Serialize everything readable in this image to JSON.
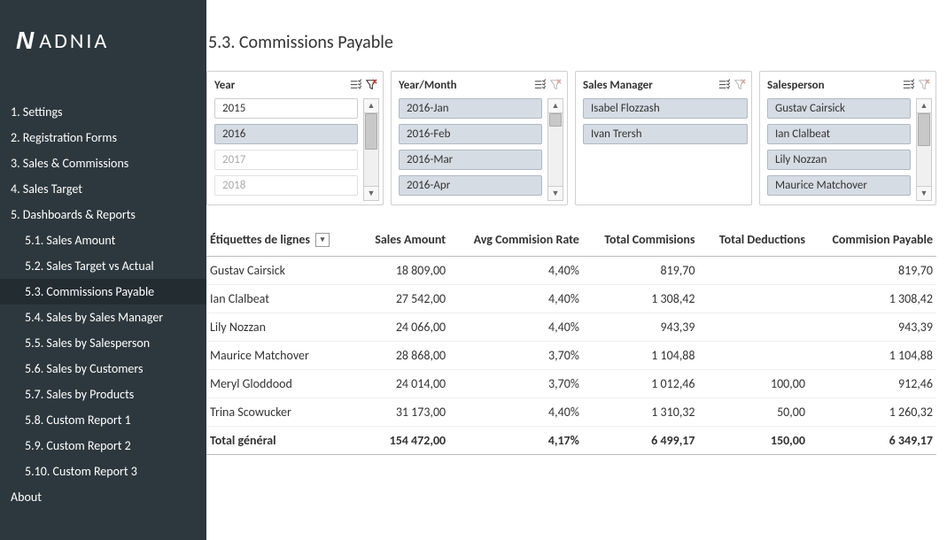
{
  "brand": {
    "logo_text": "ADNIA"
  },
  "page_title": "5.3. Commissions Payable",
  "sidebar": {
    "items": [
      {
        "label": "1. Settings",
        "sub": false
      },
      {
        "label": "2. Registration Forms",
        "sub": false
      },
      {
        "label": "3. Sales & Commissions",
        "sub": false
      },
      {
        "label": "4. Sales Target",
        "sub": false
      },
      {
        "label": "5. Dashboards & Reports",
        "sub": false
      },
      {
        "label": "5.1. Sales Amount",
        "sub": true
      },
      {
        "label": "5.2. Sales Target vs Actual",
        "sub": true
      },
      {
        "label": "5.3. Commissions Payable",
        "sub": true,
        "active": true
      },
      {
        "label": "5.4. Sales by Sales Manager",
        "sub": true
      },
      {
        "label": "5.5. Sales by Salesperson",
        "sub": true
      },
      {
        "label": "5.6. Sales by Customers",
        "sub": true
      },
      {
        "label": "5.7. Sales by Products",
        "sub": true
      },
      {
        "label": "5.8. Custom Report 1",
        "sub": true
      },
      {
        "label": "5.9. Custom Report 2",
        "sub": true
      },
      {
        "label": "5.10. Custom Report 3",
        "sub": true
      },
      {
        "label": "About",
        "sub": false
      }
    ]
  },
  "slicers": {
    "year": {
      "title": "Year",
      "items": [
        {
          "label": "2015",
          "state": "normal"
        },
        {
          "label": "2016",
          "state": "selected"
        },
        {
          "label": "2017",
          "state": "faded"
        },
        {
          "label": "2018",
          "state": "faded"
        }
      ],
      "clear_active": true,
      "scroll_thumb": {
        "top": 0,
        "height": 50
      }
    },
    "year_month": {
      "title": "Year/Month",
      "items": [
        {
          "label": "2016-Jan",
          "state": "selected"
        },
        {
          "label": "2016-Feb",
          "state": "selected"
        },
        {
          "label": "2016-Mar",
          "state": "selected"
        },
        {
          "label": "2016-Apr",
          "state": "selected"
        }
      ],
      "clear_active": false,
      "scroll_thumb": {
        "top": 0,
        "height": 18
      }
    },
    "sales_manager": {
      "title": "Sales Manager",
      "items": [
        {
          "label": "Isabel Flozzash",
          "state": "selected"
        },
        {
          "label": "Ivan Trersh",
          "state": "selected"
        }
      ],
      "clear_active": false,
      "scroll": false
    },
    "salesperson": {
      "title": "Salesperson",
      "items": [
        {
          "label": "Gustav Cairsick",
          "state": "selected"
        },
        {
          "label": "Ian Clalbeat",
          "state": "selected"
        },
        {
          "label": "Lily Nozzan",
          "state": "selected"
        },
        {
          "label": "Maurice Matchover",
          "state": "selected"
        }
      ],
      "clear_active": false,
      "scroll_thumb": {
        "top": 0,
        "height": 45
      }
    }
  },
  "table": {
    "headers": {
      "row_label": "Étiquettes de lignes",
      "sales_amount": "Sales Amount",
      "avg_rate": "Avg Commision Rate",
      "total_comm": "Total Commisions",
      "total_ded": "Total Deductions",
      "comm_payable": "Commision Payable"
    },
    "rows": [
      {
        "name": "Gustav Cairsick",
        "sales": "18 809,00",
        "rate": "4,40%",
        "comm": "819,70",
        "ded": "",
        "pay": "819,70"
      },
      {
        "name": "Ian Clalbeat",
        "sales": "27 542,00",
        "rate": "4,40%",
        "comm": "1 308,42",
        "ded": "",
        "pay": "1 308,42"
      },
      {
        "name": "Lily Nozzan",
        "sales": "24 066,00",
        "rate": "4,40%",
        "comm": "943,39",
        "ded": "",
        "pay": "943,39"
      },
      {
        "name": "Maurice Matchover",
        "sales": "28 868,00",
        "rate": "3,70%",
        "comm": "1 104,88",
        "ded": "",
        "pay": "1 104,88"
      },
      {
        "name": "Meryl Gloddood",
        "sales": "24 014,00",
        "rate": "3,70%",
        "comm": "1 012,46",
        "ded": "100,00",
        "pay": "912,46"
      },
      {
        "name": "Trina Scowucker",
        "sales": "31 173,00",
        "rate": "4,40%",
        "comm": "1 310,32",
        "ded": "50,00",
        "pay": "1 260,32"
      }
    ],
    "footer": {
      "label": "Total général",
      "sales": "154 472,00",
      "rate": "4,17%",
      "comm": "6 499,17",
      "ded": "150,00",
      "pay": "6 349,17"
    }
  },
  "chart_data": {
    "type": "table",
    "title": "5.3. Commissions Payable",
    "columns": [
      "Salesperson",
      "Sales Amount",
      "Avg Commision Rate",
      "Total Commisions",
      "Total Deductions",
      "Commision Payable"
    ],
    "rows": [
      [
        "Gustav Cairsick",
        18809.0,
        0.044,
        819.7,
        null,
        819.7
      ],
      [
        "Ian Clalbeat",
        27542.0,
        0.044,
        1308.42,
        null,
        1308.42
      ],
      [
        "Lily Nozzan",
        24066.0,
        0.044,
        943.39,
        null,
        943.39
      ],
      [
        "Maurice Matchover",
        28868.0,
        0.037,
        1104.88,
        null,
        1104.88
      ],
      [
        "Meryl Gloddood",
        24014.0,
        0.037,
        1012.46,
        100.0,
        912.46
      ],
      [
        "Trina Scowucker",
        31173.0,
        0.044,
        1310.32,
        50.0,
        1260.32
      ]
    ],
    "totals": [
      "Total général",
      154472.0,
      0.0417,
      6499.17,
      150.0,
      6349.17
    ]
  }
}
